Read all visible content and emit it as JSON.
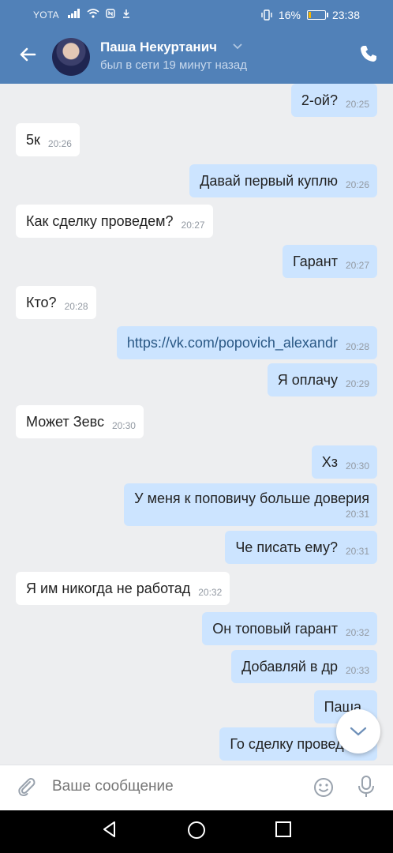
{
  "status": {
    "carrier": "YOTA",
    "battery": "16%",
    "battery_level": 0.16,
    "time": "23:38"
  },
  "header": {
    "name": "Паша Некуртанич",
    "last_seen": "был в сети 19 минут назад"
  },
  "messages": [
    {
      "dir": "out",
      "text": "2-ой?",
      "time": "20:25"
    },
    {
      "dir": "in",
      "text": "5к",
      "time": "20:26"
    },
    {
      "dir": "out",
      "text": "Давай первый куплю",
      "time": "20:26"
    },
    {
      "dir": "in",
      "text": "Как сделку проведем?",
      "time": "20:27"
    },
    {
      "dir": "out",
      "text": "Гарант",
      "time": "20:27"
    },
    {
      "dir": "in",
      "text": "Кто?",
      "time": "20:28"
    },
    {
      "dir": "out",
      "text": "https://vk.com/popovich_alexandr",
      "time": "20:28"
    },
    {
      "dir": "out",
      "text": "Я оплачу",
      "time": "20:29"
    },
    {
      "dir": "in",
      "text": "Может Зевс",
      "time": "20:30"
    },
    {
      "dir": "out",
      "text": "Хз",
      "time": "20:30"
    },
    {
      "dir": "out",
      "text": "У меня к поповичу больше доверия",
      "time": "20:31"
    },
    {
      "dir": "out",
      "text": "Че писать ему?",
      "time": "20:31"
    },
    {
      "dir": "in",
      "text": "Я им никогда не работад",
      "time": "20:32"
    },
    {
      "dir": "out",
      "text": "Он топовый гарант",
      "time": "20:32"
    },
    {
      "dir": "out",
      "text": "Добавляй в др",
      "time": "20:33"
    },
    {
      "dir": "out",
      "text": "Паша",
      "time": ""
    },
    {
      "dir": "out",
      "text": "Го сделку проведем",
      "time": ""
    }
  ],
  "composer": {
    "placeholder": "Ваше сообщение"
  },
  "icons": {
    "back": "arrow-left-icon",
    "call": "phone-icon",
    "attach": "paperclip-icon",
    "emoji": "smile-icon",
    "mic": "microphone-icon",
    "scroll": "chevron-down-icon"
  }
}
